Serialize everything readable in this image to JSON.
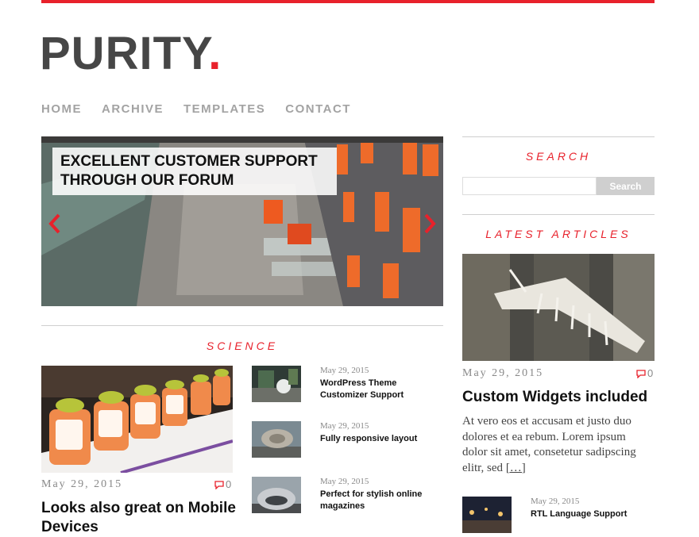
{
  "site": {
    "logo_text": "PURITY",
    "logo_dot": ".",
    "accent_color": "#e8212b"
  },
  "nav": {
    "items": [
      "HOME",
      "ARCHIVE",
      "TEMPLATES",
      "CONTACT"
    ]
  },
  "slider": {
    "caption_line1": "EXCELLENT CUSTOMER SUPPORT",
    "caption_line2": "THROUGH OUR FORUM",
    "prev_icon": "chevron-left-icon",
    "next_icon": "chevron-right-icon"
  },
  "science": {
    "section_title": "SCIENCE",
    "featured": {
      "date": "May 29, 2015",
      "comments": "0",
      "title": "Looks also great on Mobile Devices"
    },
    "list": [
      {
        "date": "May 29, 2015",
        "title": "WordPress Theme Customizer Support"
      },
      {
        "date": "May 29, 2015",
        "title": "Fully responsive layout"
      },
      {
        "date": "May 29, 2015",
        "title": "Perfect for stylish online magazines"
      }
    ]
  },
  "sidebar": {
    "search_title": "SEARCH",
    "search_placeholder": "",
    "search_button": "Search",
    "latest_title": "LATEST ARTICLES",
    "latest": {
      "date": "May 29, 2015",
      "comments": "0",
      "title": "Custom Widgets included",
      "excerpt": "At vero eos et accusam et justo duo dolores et ea rebum. Lorem ipsum dolor sit amet, consetetur sadipscing elitr, sed",
      "more": "[…]"
    },
    "small_item": {
      "date": "May 29, 2015",
      "title": "RTL Language Support"
    }
  }
}
